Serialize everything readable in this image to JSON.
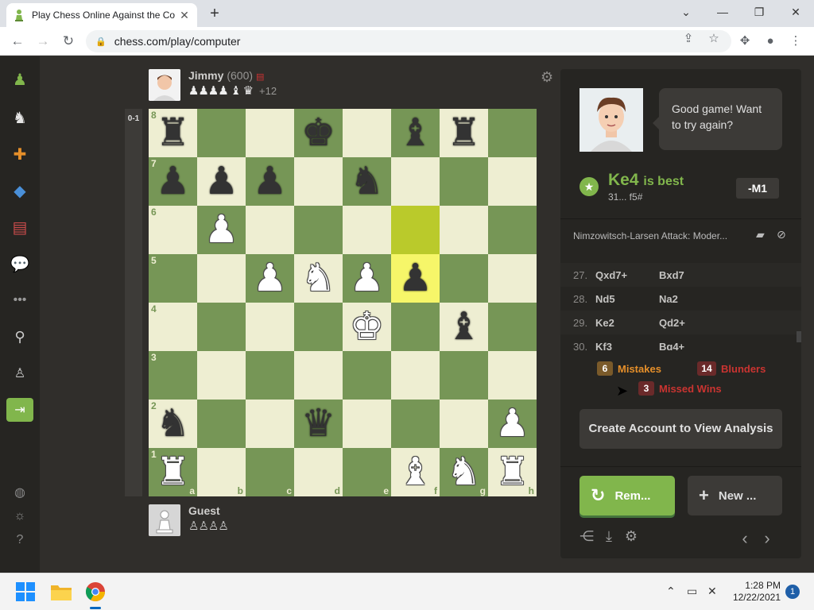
{
  "browser": {
    "tab_title": "Play Chess Online Against the Co",
    "url": "chess.com/play/computer"
  },
  "sidebar": {
    "items": [
      "pawn-logo-icon",
      "play-icon",
      "puzzles-icon",
      "learn-icon",
      "watch-icon",
      "social-icon",
      "more-icon",
      "search-icon",
      "settings-person-icon",
      "login-icon",
      "globe-icon",
      "brightness-icon",
      "help-icon"
    ]
  },
  "game": {
    "top_player": {
      "name": "Jimmy",
      "rating": "(600)",
      "captured": "♟♟♟♟ ♝ ♛",
      "advantage": "+12"
    },
    "bottom_player": {
      "name": "Guest",
      "captured": "♙♙♙♙"
    },
    "eval_label": "0-1",
    "ranks": [
      "8",
      "7",
      "6",
      "5",
      "4",
      "3",
      "2",
      "1"
    ],
    "files": [
      "a",
      "b",
      "c",
      "d",
      "e",
      "f",
      "g",
      "h"
    ],
    "board": [
      [
        "br",
        "",
        "",
        "bk",
        "",
        "bb",
        "br",
        ""
      ],
      [
        "bp",
        "bp",
        "bp",
        "",
        "bn",
        "",
        "",
        ""
      ],
      [
        "",
        "wp",
        "",
        "",
        "",
        "",
        "",
        ""
      ],
      [
        "",
        "",
        "wp",
        "wn",
        "wp",
        "bp",
        "",
        ""
      ],
      [
        "",
        "",
        "",
        "",
        "wk",
        "",
        "bb",
        ""
      ],
      [
        "",
        "",
        "",
        "",
        "",
        "",
        "",
        ""
      ],
      [
        "bn",
        "",
        "",
        "bq",
        "",
        "",
        "",
        "wp"
      ],
      [
        "wr",
        "",
        "",
        "",
        "",
        "wb",
        "wn",
        "wr"
      ]
    ],
    "highlight": [
      [
        2,
        5
      ],
      [
        3,
        5
      ]
    ]
  },
  "coach": {
    "message": "Good game! Want to try again?",
    "best_move": "Ke4",
    "best_label": "is best",
    "best_line": "31... f5#",
    "eval": "-M1",
    "opening": "Nimzowitsch-Larsen Attack: Moder..."
  },
  "moves": [
    {
      "num": "27.",
      "white": "Qxd7+",
      "black": "Bxd7"
    },
    {
      "num": "28.",
      "white": "Nd5",
      "black": "Na2"
    },
    {
      "num": "29.",
      "white": "Ke2",
      "black": "Qd2+"
    },
    {
      "num": "30.",
      "white": "Kf3",
      "black": "Bg4+"
    }
  ],
  "stats": {
    "mistakes": {
      "count": "6",
      "label": "Mistakes",
      "color": "#e58f2a"
    },
    "blunders": {
      "count": "14",
      "label": "Blunders",
      "color": "#ca3431"
    },
    "missed": {
      "count": "3",
      "label": "Missed Wins",
      "color": "#ca3431"
    }
  },
  "buttons": {
    "analysis": "Create Account to View Analysis",
    "rematch": "Rem...",
    "new_game": "New ..."
  },
  "taskbar": {
    "time": "1:28 PM",
    "date": "12/22/2021",
    "notifications": "1"
  },
  "colors": {
    "board_light": "#eeeed2",
    "board_dark": "#769656",
    "accent_green": "#81b64c"
  }
}
